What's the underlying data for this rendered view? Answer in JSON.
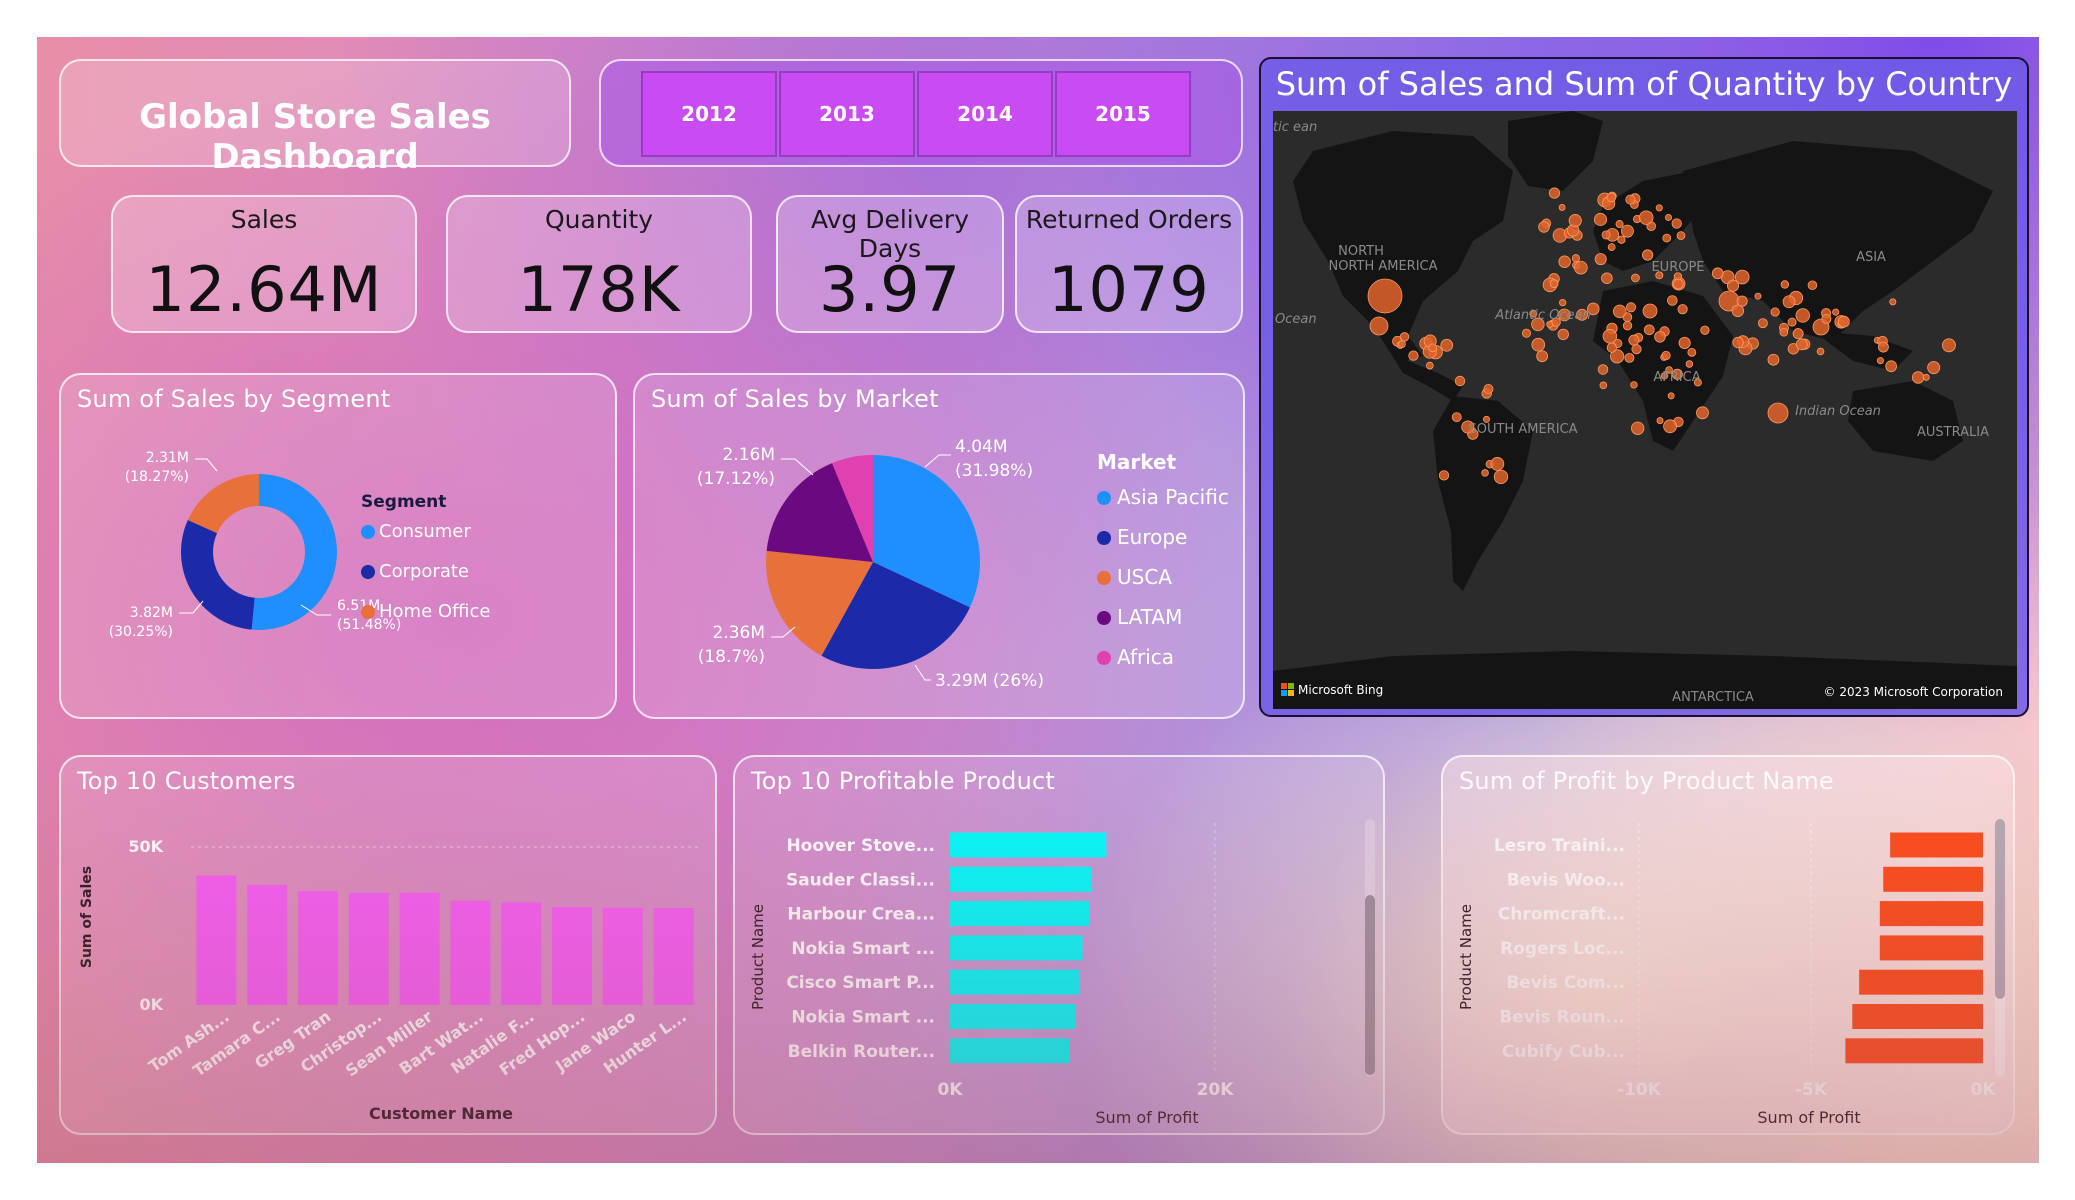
{
  "dashboard": {
    "title": "Global Store Sales Dashboard"
  },
  "years": [
    "2012",
    "2013",
    "2014",
    "2015"
  ],
  "kpis": {
    "sales": {
      "label": "Sales",
      "value": "12.64M"
    },
    "quantity": {
      "label": "Quantity",
      "value": "178K"
    },
    "delivery": {
      "label": "Avg Delivery Days",
      "value": "3.97"
    },
    "returns": {
      "label": "Returned Orders",
      "value": "1079"
    }
  },
  "map": {
    "title": "Sum of Sales and Sum of Quantity by Country",
    "labels": [
      "NORTH AMERICA",
      "EUROPE",
      "ASIA",
      "AFRICA",
      "SOUTH AMERICA",
      "AUSTRALIA",
      "ANTARCTICA",
      "Atlantic Ocean",
      "Indian Ocean",
      "Ocean",
      "tic ean"
    ],
    "bing_label": "Microsoft Bing",
    "copyright": "© 2023 Microsoft Corporation",
    "colors": {
      "bubble": "#e0642a",
      "land": "#141414",
      "water": "#2b2b2b"
    }
  },
  "chart_data": [
    {
      "type": "pie",
      "variant": "donut",
      "title": "Sum of Sales by Segment",
      "legend_title": "Segment",
      "categories": [
        "Consumer",
        "Corporate",
        "Home Office"
      ],
      "values": [
        6.51,
        3.82,
        2.31
      ],
      "labels": [
        [
          "6.51M",
          "(51.48%)"
        ],
        [
          "3.82M",
          "(30.25%)"
        ],
        [
          "2.31M",
          "(18.27%)"
        ]
      ],
      "colors": [
        "#1f8fff",
        "#1a2aa8",
        "#e8703a"
      ],
      "legend_position": "right"
    },
    {
      "type": "pie",
      "title": "Sum of Sales by Market",
      "legend_title": "Market",
      "categories": [
        "Asia Pacific",
        "Europe",
        "USCA",
        "LATAM",
        "Africa"
      ],
      "values": [
        4.04,
        3.29,
        2.36,
        2.16,
        0.79
      ],
      "labels": [
        [
          "4.04M",
          "(31.98%)"
        ],
        [
          "3.29M (26%)"
        ],
        [
          "2.36M",
          "(18.7%)"
        ],
        [
          "2.16M",
          "(17.12%)"
        ],
        []
      ],
      "colors": [
        "#1f8fff",
        "#1a2aa8",
        "#e8703a",
        "#6b0a80",
        "#e040b0"
      ],
      "legend_position": "right"
    },
    {
      "type": "bar",
      "title": "Top 10 Customers",
      "categories": [
        "Tom Ash...",
        "Tamara C...",
        "Greg Tran",
        "Christop...",
        "Sean Miller",
        "Bart Wat...",
        "Natalie F...",
        "Fred Hop...",
        "Jane Waco",
        "Hunter L..."
      ],
      "values": [
        41000,
        38000,
        36000,
        35500,
        35500,
        33000,
        32500,
        31000,
        30800,
        30700
      ],
      "xlabel": "Customer Name",
      "ylabel": "Sum of Sales",
      "yticks": [
        "0K",
        "50K"
      ],
      "ylim": [
        0,
        50000
      ],
      "color": "#f760f5"
    },
    {
      "type": "bar",
      "orientation": "horizontal",
      "title": "Top 10 Profitable Product",
      "categories": [
        "Hoover Stove...",
        "Sauder Classi...",
        "Harbour Crea...",
        "Nokia Smart ...",
        "Cisco Smart P...",
        "Nokia Smart ...",
        "Belkin Router..."
      ],
      "values": [
        11800,
        10700,
        10500,
        10000,
        9800,
        9500,
        9000
      ],
      "xlabel": "Sum of Profit",
      "ylabel": "Product Name",
      "xticks": [
        "0K",
        "20K"
      ],
      "xlim": [
        0,
        20000
      ],
      "color": "#00ffff"
    },
    {
      "type": "bar",
      "orientation": "horizontal",
      "title": "Sum of Profit by Product Name",
      "categories": [
        "Lesro Traini...",
        "Bevis Woo...",
        "Chromcraft...",
        "Rogers Loc...",
        "Bevis Com...",
        "Bevis Roun...",
        "Cubify Cub..."
      ],
      "values": [
        -2700,
        -2900,
        -3000,
        -3000,
        -3600,
        -3800,
        -4000
      ],
      "xlabel": "Sum of Profit",
      "ylabel": "Product Name",
      "xticks": [
        "-10K",
        "-5K",
        "0K"
      ],
      "xlim": [
        -10000,
        0
      ],
      "color": "#ff4d1a"
    }
  ]
}
